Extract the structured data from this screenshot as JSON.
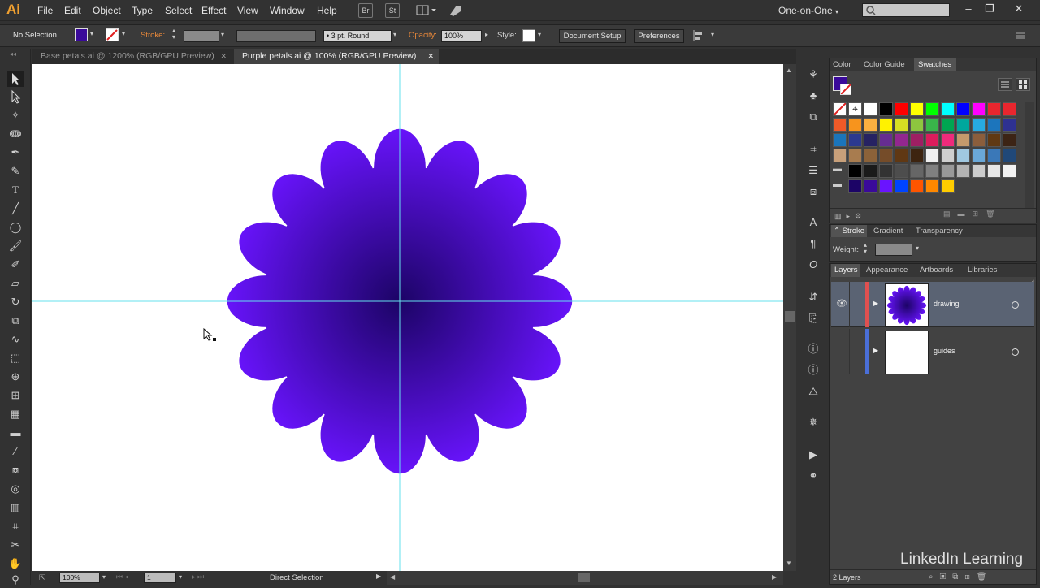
{
  "app": {
    "logo": "Ai"
  },
  "menu": [
    "File",
    "Edit",
    "Object",
    "Type",
    "Select",
    "Effect",
    "View",
    "Window",
    "Help"
  ],
  "menu_buttons": [
    "Br",
    "St"
  ],
  "workspace": "One-on-One",
  "window_controls": [
    "–",
    "❐",
    "✕"
  ],
  "control_bar": {
    "selection": "No Selection",
    "stroke_label": "Stroke:",
    "brush": "3 pt. Round",
    "opacity_label": "Opacity:",
    "opacity_value": "100%",
    "style_label": "Style:",
    "document_setup": "Document Setup",
    "preferences": "Preferences"
  },
  "tabs": [
    {
      "label": "Base petals.ai @ 1200% (RGB/GPU Preview)",
      "close": "✕"
    },
    {
      "label": "Purple petals.ai @ 100% (RGB/GPU Preview)",
      "close": "✕"
    }
  ],
  "status": {
    "zoom": "100%",
    "artboard": "1",
    "tool": "Direct Selection"
  },
  "swatch_panel": {
    "tabs": [
      "Color",
      "Color Guide",
      "Swatches"
    ]
  },
  "stroke_panel": {
    "tabs": [
      "Stroke",
      "Gradient",
      "Transparency"
    ],
    "weight_label": "Weight:"
  },
  "layers_panel": {
    "tabs": [
      "Layers",
      "Appearance",
      "Artboards",
      "Libraries"
    ],
    "layers": [
      {
        "name": "drawing",
        "color": "#e05050"
      },
      {
        "name": "guides",
        "color": "#4a6fd8"
      }
    ],
    "count": "2 Layers"
  },
  "colors": {
    "flower_center": "#1c0466",
    "flower_edge": "#6a14ff",
    "guide": "#66e0ee",
    "fill_swatch": "#3a0a9a"
  },
  "watermark": "LinkedIn Learning"
}
